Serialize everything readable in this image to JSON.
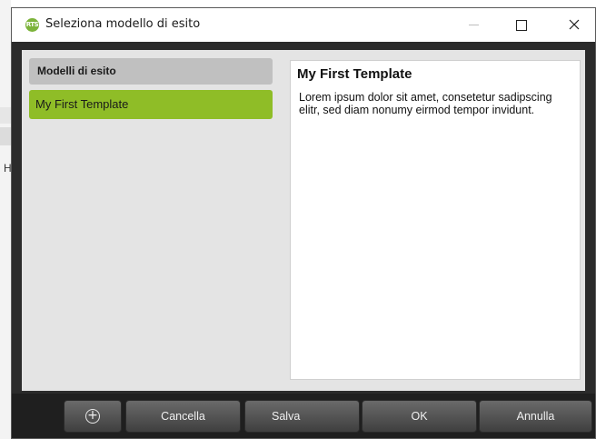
{
  "window": {
    "title": "Seleziona modello di esito",
    "app_icon": "rts-logo-icon",
    "controls": {
      "minimize": "minimize-icon",
      "maximize": "maximize-icon",
      "close_glyph": "✕"
    }
  },
  "background": {
    "partial_letter": "H"
  },
  "list": {
    "header": "Modelli di esito",
    "items": [
      {
        "label": "My First Template",
        "selected": true
      }
    ]
  },
  "preview": {
    "title": "My First Template",
    "body": "Lorem ipsum dolor sit amet, consetetur sadipscing elitr, sed diam nonumy eirmod tempor invidunt."
  },
  "toolbar": {
    "add_glyph": "+",
    "cancella_label": "Cancella",
    "salva_label": "Salva",
    "ok_label": "OK",
    "annulla_label": "Annulla"
  },
  "colors": {
    "selected_item": "#8fbd27",
    "app_icon": "#7cb33a",
    "toolbar_bg": "#1f1f1f",
    "content_bg": "#e4e4e4"
  }
}
